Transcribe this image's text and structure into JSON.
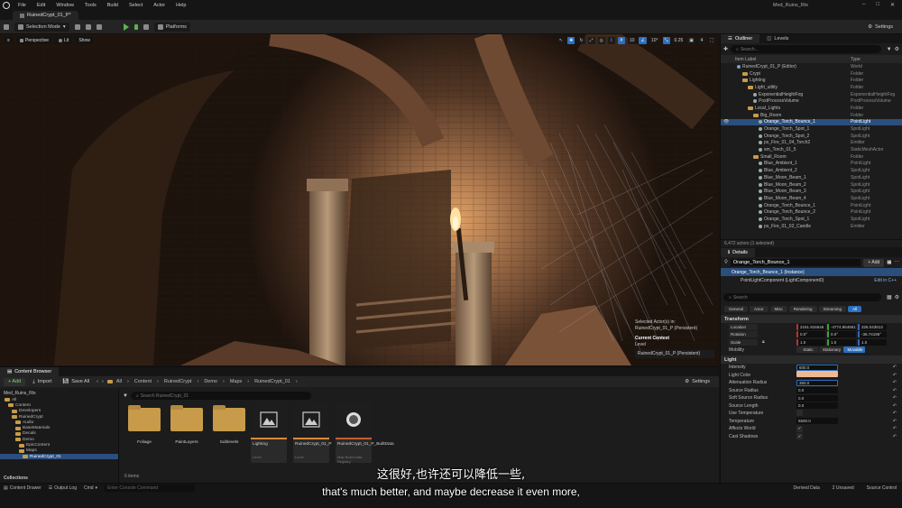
{
  "menubar": {
    "items": [
      "File",
      "Edit",
      "Window",
      "Tools",
      "Build",
      "Select",
      "Actor",
      "Help"
    ],
    "project": "Med_Ruins_Rtx",
    "controls": [
      "–",
      "□",
      "✕"
    ]
  },
  "level_tab": {
    "label": "RuinedCrypt_01_P*"
  },
  "toolbar": {
    "mode": "Selection Mode",
    "platforms": "Platforms",
    "settings": "Settings"
  },
  "viewport": {
    "perspective": "Perspective",
    "lit": "Lit",
    "show": "Show",
    "snap_grid": "10",
    "snap_angle": "10°",
    "snap_scale": "0.25",
    "camera_speed": "4",
    "selected_actor_text": "Selected Actor(s) in:",
    "selected_actor_level": "RuinedCrypt_01_P (Persistent)",
    "current_context": "Current Context",
    "level_label": "Level",
    "level_value": "RuinedCrypt_01_P (Persistent)"
  },
  "outliner": {
    "tab": "Outliner",
    "levels_tab": "Levels",
    "search_placeholder": "Search...",
    "col_label": "Item Label",
    "col_type": "Type",
    "rows": [
      {
        "label": "RuinedCrypt_01_P (Editor)",
        "type": "World",
        "kind": "world",
        "indent": 1
      },
      {
        "label": "Crypt",
        "type": "Folder",
        "kind": "folder",
        "indent": 2
      },
      {
        "label": "Lighting",
        "type": "Folder",
        "kind": "folder",
        "indent": 2
      },
      {
        "label": "Light_utility",
        "type": "Folder",
        "kind": "folder",
        "indent": 3
      },
      {
        "label": "ExponentialHeightFog",
        "type": "ExponentialHeightFog",
        "kind": "actor",
        "indent": 4
      },
      {
        "label": "PostProcessVolume",
        "type": "PostProcessVolume",
        "kind": "actor",
        "indent": 4
      },
      {
        "label": "Local_Lights",
        "type": "Folder",
        "kind": "folder",
        "indent": 3
      },
      {
        "label": "Big_Room",
        "type": "Folder",
        "kind": "folder",
        "indent": 4
      },
      {
        "label": "Orange_Torch_Bounce_1",
        "type": "PointLight",
        "kind": "actor",
        "indent": 5,
        "selected": true
      },
      {
        "label": "Orange_Torch_Spot_1",
        "type": "SpotLight",
        "kind": "actor",
        "indent": 5
      },
      {
        "label": "Orange_Torch_Spot_2",
        "type": "SpotLight",
        "kind": "actor",
        "indent": 5
      },
      {
        "label": "ps_Fire_01_04_Torch2",
        "type": "Emitter",
        "kind": "actor",
        "indent": 5
      },
      {
        "label": "sm_Torch_01_5",
        "type": "StaticMeshActor",
        "kind": "actor",
        "indent": 5
      },
      {
        "label": "Small_Room",
        "type": "Folder",
        "kind": "folder",
        "indent": 4
      },
      {
        "label": "Blue_Ambient_1",
        "type": "PointLight",
        "kind": "actor",
        "indent": 5
      },
      {
        "label": "Blue_Ambient_2",
        "type": "SpotLight",
        "kind": "actor",
        "indent": 5
      },
      {
        "label": "Blue_Moon_Beam_1",
        "type": "SpotLight",
        "kind": "actor",
        "indent": 5
      },
      {
        "label": "Blue_Moon_Beam_2",
        "type": "SpotLight",
        "kind": "actor",
        "indent": 5
      },
      {
        "label": "Blue_Moon_Beam_3",
        "type": "SpotLight",
        "kind": "actor",
        "indent": 5
      },
      {
        "label": "Blue_Moon_Beam_4",
        "type": "SpotLight",
        "kind": "actor",
        "indent": 5
      },
      {
        "label": "Orange_Torch_Bounce_1",
        "type": "PointLight",
        "kind": "actor",
        "indent": 5
      },
      {
        "label": "Orange_Torch_Bounce_2",
        "type": "PointLight",
        "kind": "actor",
        "indent": 5
      },
      {
        "label": "Orange_Torch_Spot_1",
        "type": "SpotLight",
        "kind": "actor",
        "indent": 5
      },
      {
        "label": "ps_Fire_01_02_Candle",
        "type": "Emitter",
        "kind": "actor",
        "indent": 5
      }
    ],
    "footer": "6,472 actors (1 selected)"
  },
  "details": {
    "tab": "Details",
    "actor_name": "Orange_Torch_Bounce_1",
    "add_label": "+ Add",
    "instance_label": "Orange_Torch_Bounce_1 (Instance)",
    "component_label": "PointLightComponent (LightComponent0)",
    "edit_cpp": "Edit in C++",
    "search_placeholder": "Search",
    "categories": [
      "General",
      "Actor",
      "Misc",
      "Rendering",
      "Streaming",
      "All"
    ],
    "transform_section": "Transform",
    "location_label": "Location",
    "location": [
      "2161.916646",
      "-4774.864861",
      "326.043613"
    ],
    "rotation_label": "Rotation",
    "rotation": [
      "0.0°",
      "0.0°",
      "-36.74195°"
    ],
    "scale_label": "Scale",
    "scale": [
      "1.0",
      "1.0",
      "1.0"
    ],
    "mobility_label": "Mobility",
    "mobility": [
      "Static",
      "Stationary",
      "Movable"
    ],
    "light_section": "Light",
    "light_props": [
      {
        "label": "Intensity",
        "value": "600.0"
      },
      {
        "label": "Light Color",
        "value": ""
      },
      {
        "label": "Attenuation Radius",
        "value": "350.0"
      },
      {
        "label": "Source Radius",
        "value": "0.0"
      },
      {
        "label": "Soft Source Radius",
        "value": "0.0"
      },
      {
        "label": "Source Length",
        "value": "0.0"
      },
      {
        "label": "Use Temperature",
        "value": ""
      },
      {
        "label": "Temperature",
        "value": "6500.0"
      },
      {
        "label": "Affects World",
        "value": ""
      },
      {
        "label": "Cast Shadows",
        "value": ""
      }
    ],
    "light_color_hex": "#f0b890"
  },
  "content_browser": {
    "tab": "Content Browser",
    "add": "+ Add",
    "import": "Import",
    "save_all": "Save All",
    "breadcrumb": [
      "All",
      "Content",
      "RuinedCrypt",
      "Demo",
      "Maps",
      "RuinedCrypt_01"
    ],
    "settings": "Settings",
    "search_placeholder": "Search RuinedCrypt_01",
    "tree_root": "Med_Ruins_Rtx",
    "tree": [
      {
        "label": "All",
        "indent": 0
      },
      {
        "label": "Content",
        "indent": 1
      },
      {
        "label": "Developers",
        "indent": 2
      },
      {
        "label": "RuinedCrypt",
        "indent": 2
      },
      {
        "label": "Audio",
        "indent": 3
      },
      {
        "label": "BaseMaterials",
        "indent": 3
      },
      {
        "label": "Decals",
        "indent": 3
      },
      {
        "label": "Demo",
        "indent": 3
      },
      {
        "label": "EpicContent",
        "indent": 4
      },
      {
        "label": "Maps",
        "indent": 4
      },
      {
        "label": "RuinedCrypt_01",
        "indent": 5,
        "selected": true
      }
    ],
    "collections": "Collections",
    "assets": [
      {
        "name": "Foliage",
        "kind": "folder"
      },
      {
        "name": "PaintLayers",
        "kind": "folder"
      },
      {
        "name": "Sublevels",
        "kind": "folder"
      },
      {
        "name": "Lighting",
        "kind": "level",
        "type": "Level"
      },
      {
        "name": "RuinedCrypt_01_P",
        "kind": "level",
        "type": "Level"
      },
      {
        "name": "RuinedCrypt_01_P_BuiltData",
        "kind": "builtdata",
        "type": "Map Build Data Registry"
      }
    ],
    "item_count": "6 items"
  },
  "statusbar": {
    "content_drawer": "Content Drawer",
    "output_log": "Output Log",
    "cmd": "Cmd",
    "cmd_placeholder": "Enter Console Command",
    "derived_data": "Derived Data",
    "unsaved": "2 Unsaved",
    "source_control": "Source Control"
  },
  "subtitles": {
    "zh": "这很好,也许还可以降低一些,",
    "en": "that's much better, and maybe decrease it even more,"
  }
}
